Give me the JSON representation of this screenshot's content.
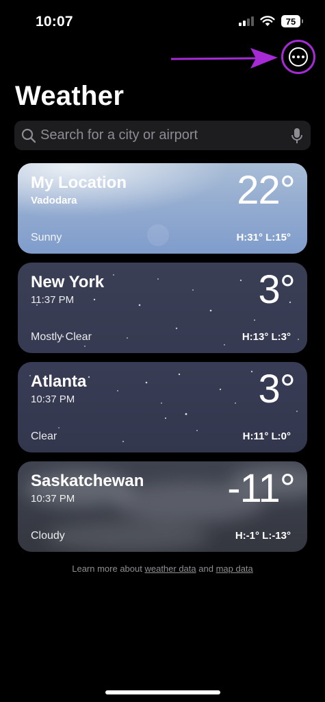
{
  "status": {
    "time": "10:07",
    "battery": "75"
  },
  "header": {
    "title": "Weather",
    "more_icon": "ellipsis-circle-icon"
  },
  "search": {
    "placeholder": "Search for a city or airport"
  },
  "locations": [
    {
      "city": "My Location",
      "sub": "Vadodara",
      "temp": "22°",
      "condition": "Sunny",
      "hl": "H:31°  L:15°"
    },
    {
      "city": "New York",
      "sub": "11:37 PM",
      "temp": "3°",
      "condition": "Mostly Clear",
      "hl": "H:13°  L:3°"
    },
    {
      "city": "Atlanta",
      "sub": "10:37 PM",
      "temp": "3°",
      "condition": "Clear",
      "hl": "H:11°  L:0°"
    },
    {
      "city": "Saskatchewan",
      "sub": "10:37 PM",
      "temp": "-11°",
      "condition": "Cloudy",
      "hl": "H:-1°  L:-13°"
    }
  ],
  "footer": {
    "prefix": "Learn more about ",
    "link1": "weather data",
    "middle": " and ",
    "link2": "map data"
  },
  "colors": {
    "annotation": "#a62bd6"
  }
}
